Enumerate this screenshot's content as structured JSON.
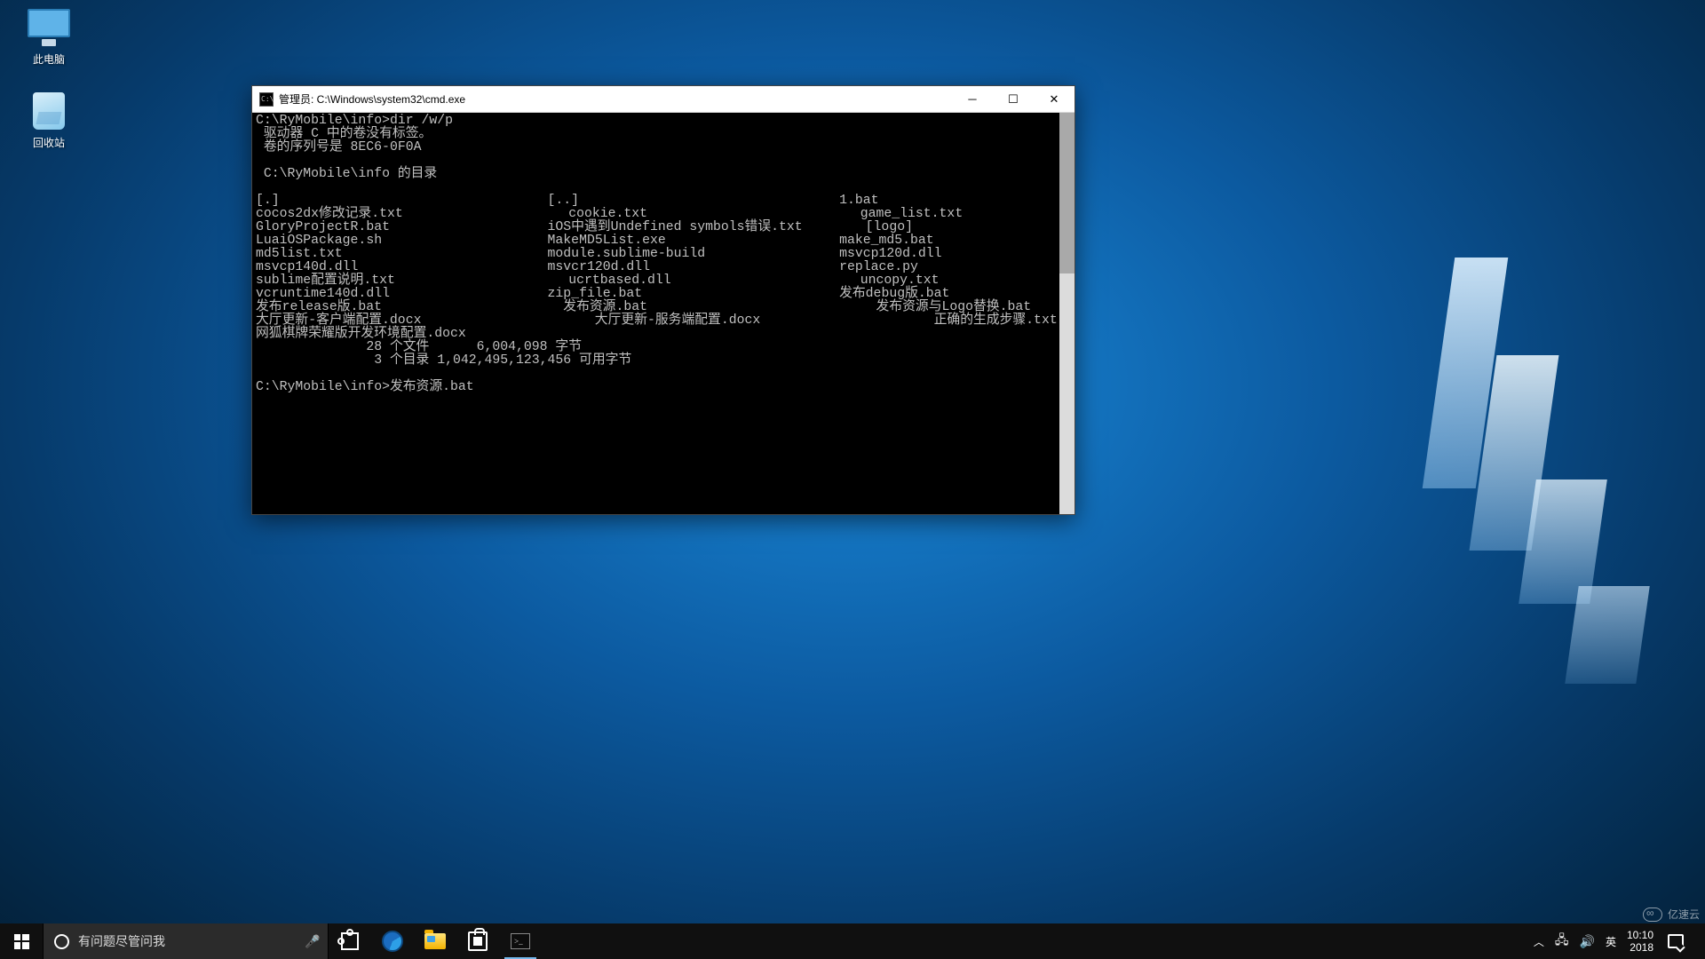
{
  "desktop": {
    "icons": {
      "this_pc": "此电脑",
      "recycle_bin": "回收站"
    }
  },
  "cmd": {
    "title": "管理员: C:\\Windows\\system32\\cmd.exe",
    "prompt1": "C:\\RyMobile\\info>dir /w/p",
    "vol_line": " 驱动器 C 中的卷没有标签。",
    "serial_line": " 卷的序列号是 8EC6-0F0A",
    "dir_of": " C:\\RyMobile\\info 的目录",
    "rows": [
      [
        "[.]",
        "[..]",
        "1.bat"
      ],
      [
        "cocos2dx修改记录.txt",
        "cookie.txt",
        "game_list.txt"
      ],
      [
        "GloryProjectR.bat",
        "iOS中遇到Undefined symbols错误.txt",
        "[logo]"
      ],
      [
        "LuaiOSPackage.sh",
        "MakeMD5List.exe",
        "make_md5.bat"
      ],
      [
        "md5list.txt",
        "module.sublime-build",
        "msvcp120d.dll"
      ],
      [
        "msvcp140d.dll",
        "msvcr120d.dll",
        "replace.py"
      ],
      [
        "sublime配置说明.txt",
        "ucrtbased.dll",
        "uncopy.txt"
      ],
      [
        "vcruntime140d.dll",
        "zip_file.bat",
        "发布debug版.bat"
      ],
      [
        "发布release版.bat",
        "发布资源.bat",
        "发布资源与Logo替换.bat"
      ],
      [
        "大厅更新-客户端配置.docx",
        "大厅更新-服务端配置.docx",
        "正确的生成步骤.txt"
      ],
      [
        "网狐棋牌荣耀版开发环境配置.docx",
        "",
        ""
      ]
    ],
    "summary1": "              28 个文件      6,004,098 字节",
    "summary2": "               3 个目录 1,042,495,123,456 可用字节",
    "prompt2": "C:\\RyMobile\\info>发布资源.bat"
  },
  "taskbar": {
    "search_placeholder": "有问题尽管问我",
    "ime": "英",
    "time": "10:10",
    "date": "2018"
  },
  "watermark": "亿速云"
}
